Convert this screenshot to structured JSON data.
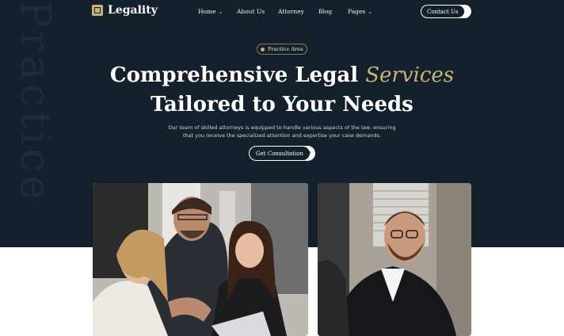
{
  "background_word": "Practice",
  "nav": {
    "logo": "Legality",
    "items": [
      {
        "label": "Home",
        "has_caret": true
      },
      {
        "label": "About Us",
        "has_caret": false
      },
      {
        "label": "Attorney",
        "has_caret": false
      },
      {
        "label": "Blog",
        "has_caret": false
      },
      {
        "label": "Pages",
        "has_caret": true
      }
    ],
    "contact_label": "Contact Us"
  },
  "hero": {
    "badge": "Practice Area",
    "headline_line1": "Comprehensive Legal",
    "headline_accent": "Services",
    "headline_line2": "Tailored to Your Needs",
    "desc_line1": "Our team of skilled attorneys is equipped to handle various aspects of the law, ensuring",
    "desc_line2": "that you receive the specialized attention and expertise your case demands.",
    "cta_label": "Get Consultation"
  },
  "colors": {
    "dark_bg": "#14202b",
    "accent_gold": "#c9b37e",
    "white": "#ffffff"
  }
}
